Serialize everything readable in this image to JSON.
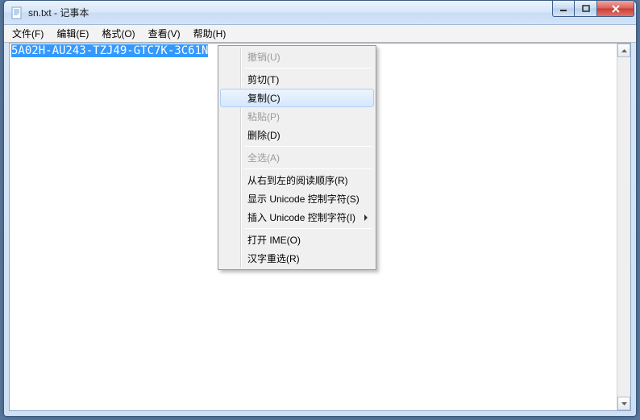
{
  "title": "sn.txt - 记事本",
  "menubar": {
    "file": "文件(F)",
    "edit": "编辑(E)",
    "format": "格式(O)",
    "view": "查看(V)",
    "help": "帮助(H)"
  },
  "editor": {
    "selected_text": "5A02H-AU243-TZJ49-GTC7K-3C61N"
  },
  "context_menu": {
    "undo": "撤销(U)",
    "cut": "剪切(T)",
    "copy": "复制(C)",
    "paste": "粘贴(P)",
    "delete": "删除(D)",
    "select_all": "全选(A)",
    "rtl_reading": "从右到左的阅读顺序(R)",
    "show_unicode": "显示 Unicode 控制字符(S)",
    "insert_unicode": "插入 Unicode 控制字符(I)",
    "open_ime": "打开 IME(O)",
    "reconversion": "汉字重选(R)"
  },
  "colors": {
    "selection_bg": "#3399ff",
    "close_red": "#c83c33"
  }
}
